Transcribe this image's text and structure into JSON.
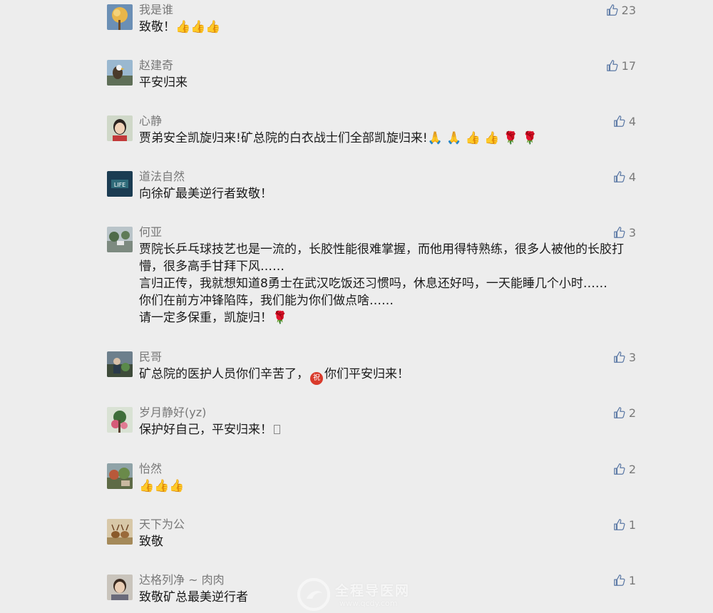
{
  "comments": [
    {
      "name": "我是谁",
      "likes": "23",
      "text": "致敬！👍👍👍"
    },
    {
      "name": "赵建奇",
      "likes": "17",
      "text": "平安归来"
    },
    {
      "name": "心静",
      "likes": "4",
      "text": "贾弟安全凯旋归来!矿总院的白衣战士们全部凯旋归来!🙏 🙏 👍 👍 🌹 🌹"
    },
    {
      "name": "道法自然",
      "likes": "4",
      "text": "向徐矿最美逆行者致敬！"
    },
    {
      "name": "何亚",
      "likes": "3",
      "lines": [
        "贾院长乒乓球技艺也是一流的，长胶性能很难掌握，而他用得特熟练，很多人被他的长胶打懵，很多高手甘拜下风……",
        "言归正传，我就想知道8勇士在武汉吃饭还习惯吗，休息还好吗，一天能睡几个小时……",
        "你们在前方冲锋陷阵，我们能为你们做点啥……",
        "请一定多保重，凯旋归！🌹"
      ]
    },
    {
      "name": "民哥",
      "likes": "3",
      "text_a": "矿总院的医护人员你们辛苦了，",
      "badge": "祝",
      "text_b": "你们平安归来！"
    },
    {
      "name": "岁月静好(yz)",
      "likes": "2",
      "text": "保护好自己，平安归来！"
    },
    {
      "name": "怡然",
      "likes": "2",
      "text": "👍👍👍"
    },
    {
      "name": "天下为公",
      "likes": "1",
      "text": "致敬"
    },
    {
      "name": "达格列净 ~ 肉肉",
      "likes": "1",
      "text": "致敬矿总最美逆行者"
    }
  ],
  "icons": {
    "like": "thumbs-up-icon"
  },
  "watermark": {
    "title": "全程导医网",
    "url": "www.qcdy.com"
  },
  "colors": {
    "background": "#ededed",
    "name": "#787878",
    "text": "#1a1a1a",
    "like": "#7a7a7a"
  }
}
